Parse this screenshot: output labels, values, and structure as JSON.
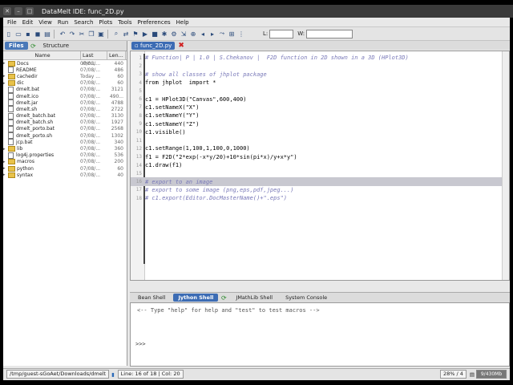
{
  "window": {
    "title": "DataMelt IDE: func_2D.py"
  },
  "menu": [
    "File",
    "Edit",
    "View",
    "Run",
    "Search",
    "Plots",
    "Tools",
    "Preferences",
    "Help"
  ],
  "toolbar": {
    "line_label": "L:",
    "width_label": "W:"
  },
  "left_panel": {
    "tabs": [
      "Files",
      "Structure"
    ],
    "columns": [
      "Name",
      "Last mo...",
      "Len..."
    ],
    "files": [
      {
        "name": "Docs",
        "date": "07/08/...",
        "size": "440",
        "type": "folder"
      },
      {
        "name": "README",
        "date": "07/08/...",
        "size": "486",
        "type": "file"
      },
      {
        "name": "cachedir",
        "date": "Today ...",
        "size": "60",
        "type": "folder"
      },
      {
        "name": "dic",
        "date": "07/08/...",
        "size": "60",
        "type": "folder"
      },
      {
        "name": "dmelt.bat",
        "date": "07/08/...",
        "size": "3121",
        "type": "file"
      },
      {
        "name": "dmelt.ico",
        "date": "07/08/...",
        "size": "490...",
        "type": "file"
      },
      {
        "name": "dmelt.jar",
        "date": "07/08/...",
        "size": "4788",
        "type": "file"
      },
      {
        "name": "dmelt.sh",
        "date": "07/08/...",
        "size": "2722",
        "type": "file"
      },
      {
        "name": "dmelt_batch.bat",
        "date": "07/08/...",
        "size": "3130",
        "type": "file"
      },
      {
        "name": "dmelt_batch.sh",
        "date": "07/08/...",
        "size": "1927",
        "type": "file"
      },
      {
        "name": "dmelt_porto.bat",
        "date": "07/08/...",
        "size": "2568",
        "type": "file"
      },
      {
        "name": "dmelt_porto.sh",
        "date": "07/08/...",
        "size": "1302",
        "type": "file"
      },
      {
        "name": "jcp.bat",
        "date": "07/08/...",
        "size": "340",
        "type": "file"
      },
      {
        "name": "lib",
        "date": "07/08/...",
        "size": "360",
        "type": "folder"
      },
      {
        "name": "log4j.properties",
        "date": "07/08/...",
        "size": "536",
        "type": "file"
      },
      {
        "name": "macros",
        "date": "07/08/...",
        "size": "200",
        "type": "folder"
      },
      {
        "name": "python",
        "date": "07/08/...",
        "size": "60",
        "type": "folder"
      },
      {
        "name": "syntax",
        "date": "07/08/...",
        "size": "40",
        "type": "folder"
      }
    ]
  },
  "editor": {
    "tab": "func_2D.py",
    "lines": [
      {
        "n": "1",
        "text": "# Function| P | 1.0 | S.Chekanov |  F2D function in 2D shown in a 3D (HPlot3D)",
        "kind": "cmt"
      },
      {
        "n": "2",
        "text": "",
        "kind": "code"
      },
      {
        "n": "3",
        "text": "# show all classes of jhplot package",
        "kind": "cmt"
      },
      {
        "n": "4",
        "text": "from jhplot  import *",
        "kind": "code"
      },
      {
        "n": "5",
        "text": "",
        "kind": "code"
      },
      {
        "n": "6",
        "text": "c1 = HPlot3D(\"Canvas\",600,400)",
        "kind": "code"
      },
      {
        "n": "7",
        "text": "c1.setNameX(\"X\")",
        "kind": "code"
      },
      {
        "n": "8",
        "text": "c1.setNameY(\"Y\")",
        "kind": "code"
      },
      {
        "n": "9",
        "text": "c1.setNameY(\"Z\")",
        "kind": "code"
      },
      {
        "n": "10",
        "text": "c1.visible()",
        "kind": "code"
      },
      {
        "n": "11",
        "text": "",
        "kind": "code"
      },
      {
        "n": "12",
        "text": "c1.setRange(1,100,1,100,0,1000)",
        "kind": "code"
      },
      {
        "n": "13",
        "text": "f1 = F2D(\"2*exp(-x*y/20)+10*sin(pi*x)/y+x*y\")",
        "kind": "code"
      },
      {
        "n": "14",
        "text": "c1.draw(f1)",
        "kind": "code"
      },
      {
        "n": "15",
        "text": "",
        "kind": "code"
      },
      {
        "n": "16",
        "text": "# export to an image",
        "kind": "cmt",
        "hl": true
      },
      {
        "n": "17",
        "text": "# export to some image (png,eps,pdf,jpeg...)",
        "kind": "cmt"
      },
      {
        "n": "18",
        "text": "# c1.export(Editor.DocMasterName()+\".eps\")",
        "kind": "cmt"
      }
    ]
  },
  "shell": {
    "tabs": [
      "Bean Shell",
      "Jython Shell",
      "JMathLib Shell",
      "System Console"
    ],
    "help_text": "<-- Type \"help\" for help and \"test\" to test macros -->",
    "prompt": ">>>"
  },
  "status": {
    "path": "/tmp/guest-sGoAet/Downloads/dmelt",
    "position": "Line: 16 of 18 | Col: 20",
    "zoom": "28% / 4",
    "memory": "9/430Mb"
  }
}
